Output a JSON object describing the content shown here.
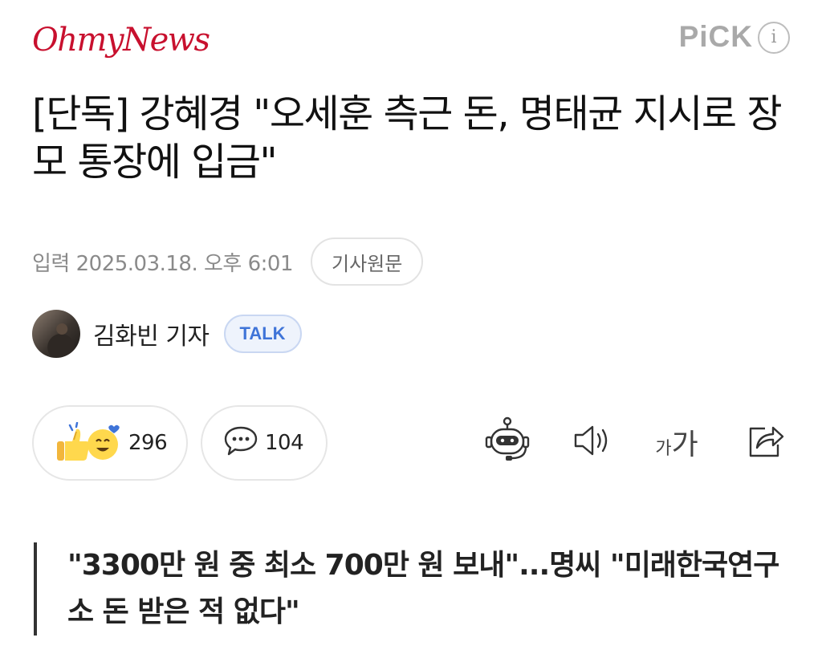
{
  "brand": {
    "logo_text": "OhmyNews",
    "pick_label": "PiCK",
    "info_label": "i"
  },
  "article": {
    "headline": "[단독] 강혜경 \"오세훈 측근 돈, 명태균 지시로 장모 통장에 입금\"",
    "date": "입력 2025.03.18. 오후 6:01",
    "original_button": "기사원문",
    "author_name": "김화빈 기자",
    "talk_button": "TALK",
    "subtitle": "\"3300만 원 중 최소 700만 원 보내\"...명씨 \"미래한국연구소 돈 받은 적 없다\""
  },
  "actions": {
    "reactions_count": "296",
    "comments_count": "104",
    "font_small": "가",
    "font_big": "가"
  },
  "icons": {
    "reaction": "thumbs-up-smile-emoji-icon",
    "comment": "speech-bubble-icon",
    "summary": "robot-icon",
    "listen": "speaker-icon",
    "font_size": "font-size-icon",
    "share": "share-icon"
  },
  "colors": {
    "brand_red": "#c8102e",
    "talk_blue": "#3f74d8",
    "muted_gray": "#8a8a8a"
  }
}
